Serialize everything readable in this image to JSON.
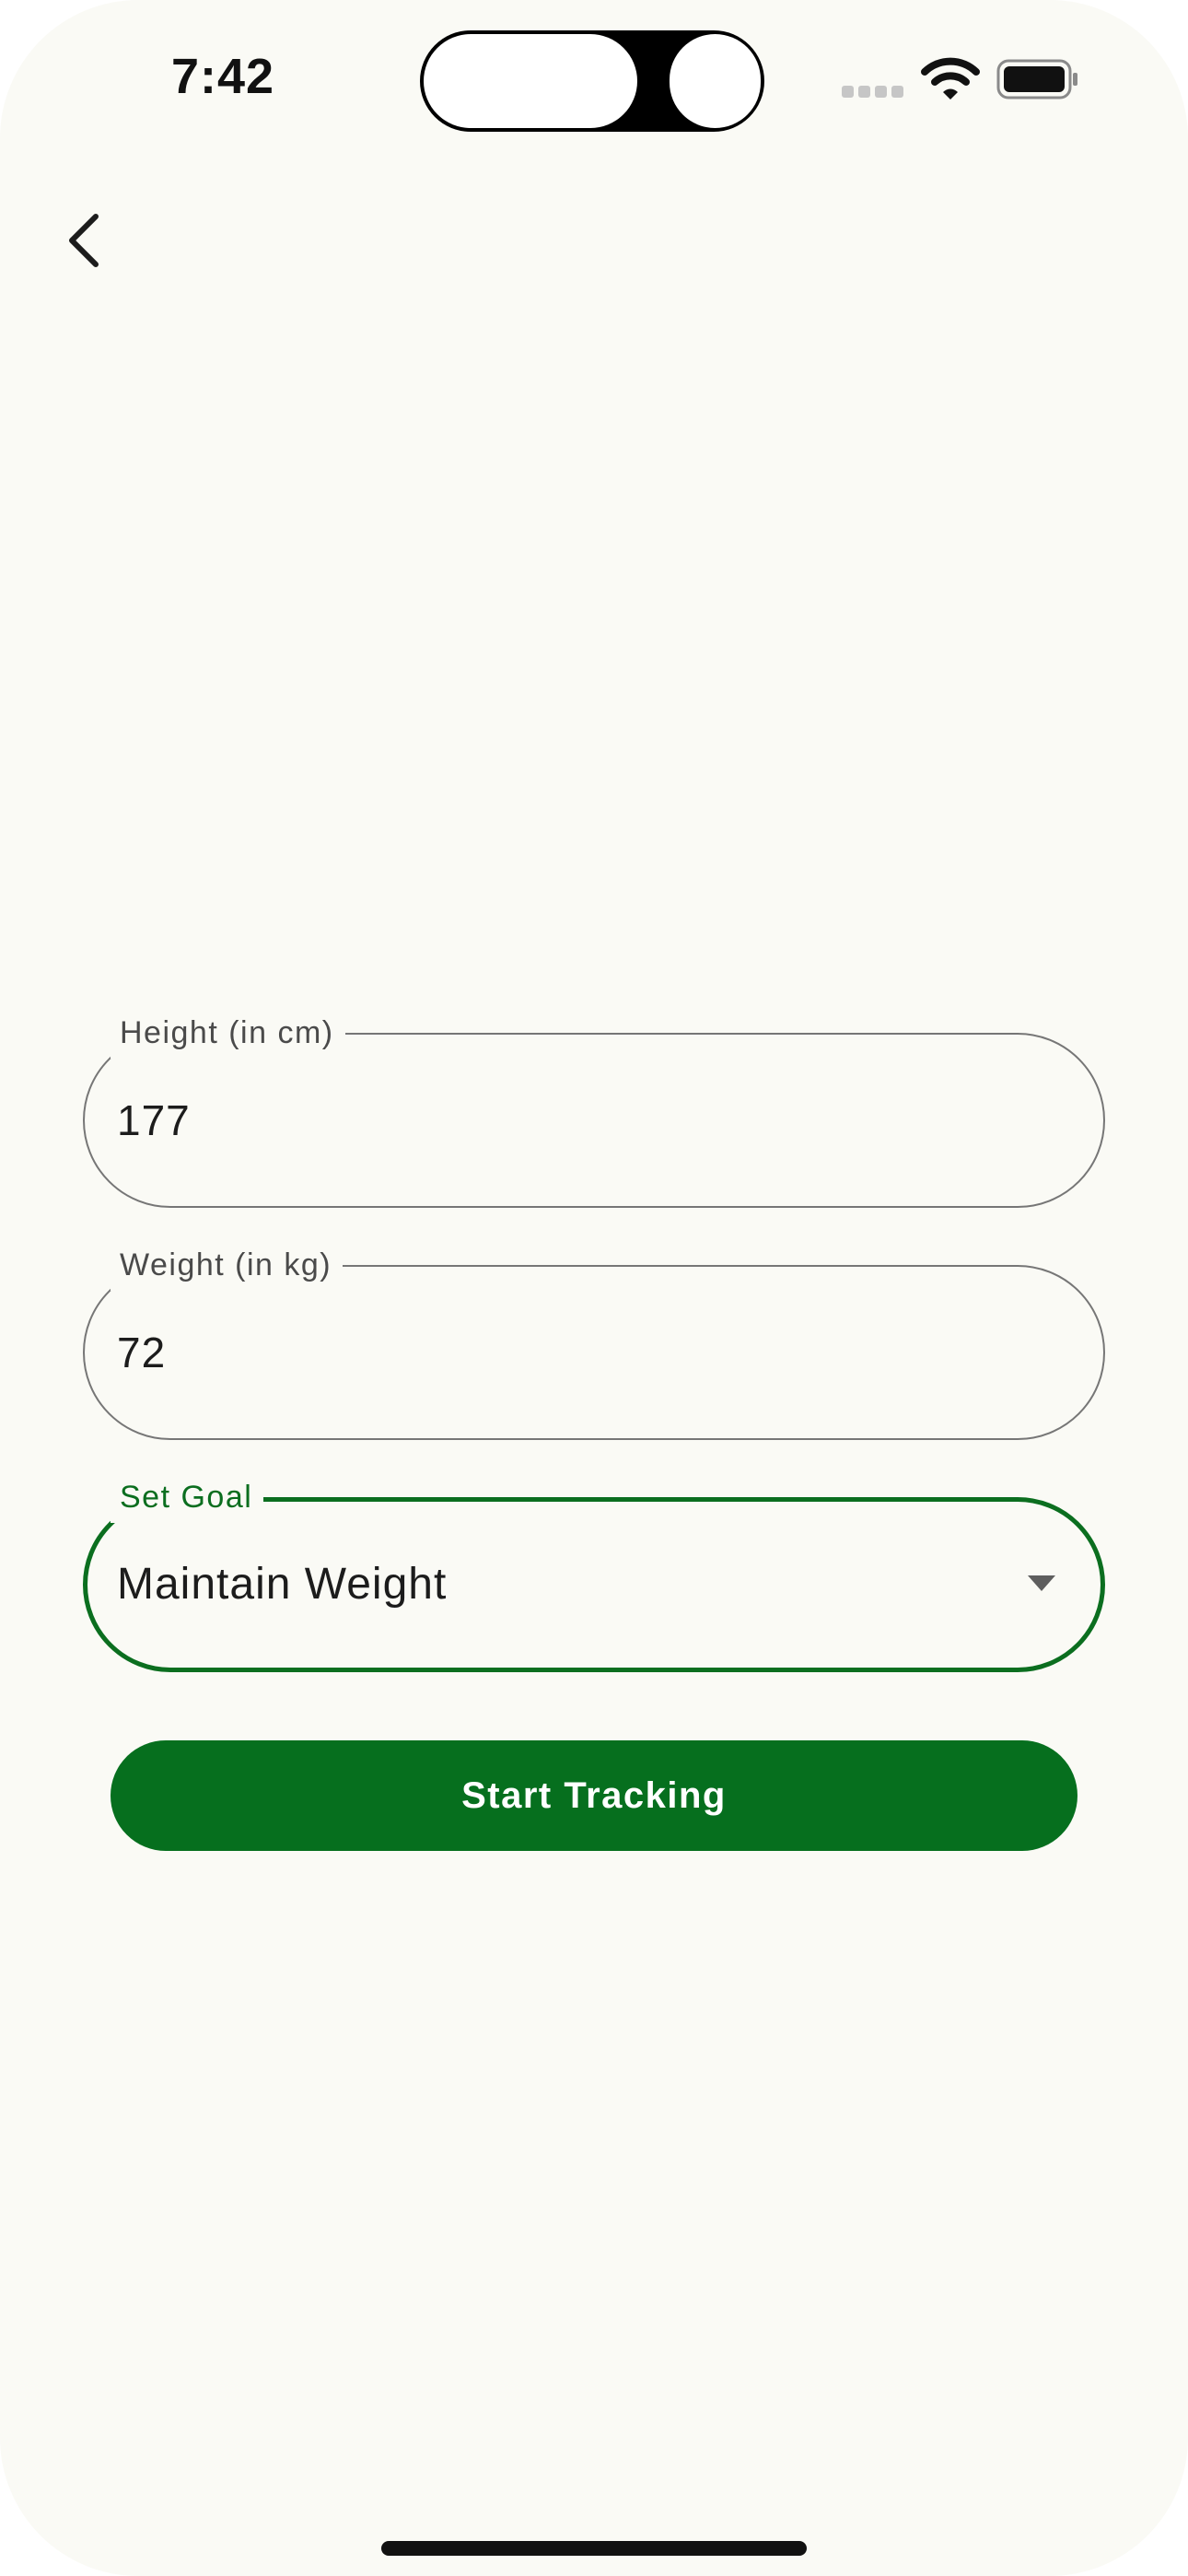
{
  "status_bar": {
    "time": "7:42",
    "wifi_icon": "wifi-icon",
    "battery_icon": "battery-full-icon",
    "signal_icon": "cellular-signal-icon"
  },
  "nav": {
    "back_icon": "chevron-left-icon"
  },
  "form": {
    "height_label": "Height (in cm)",
    "height_value": "177",
    "weight_label": "Weight (in kg)",
    "weight_value": "72",
    "goal_label": "Set Goal",
    "goal_value": "Maintain Weight",
    "goal_dropdown_icon": "dropdown-arrow-icon",
    "submit_label": "Start Tracking"
  },
  "colors": {
    "accent": "#066f1e",
    "background": "#fafaf5",
    "outline": "#767676"
  }
}
